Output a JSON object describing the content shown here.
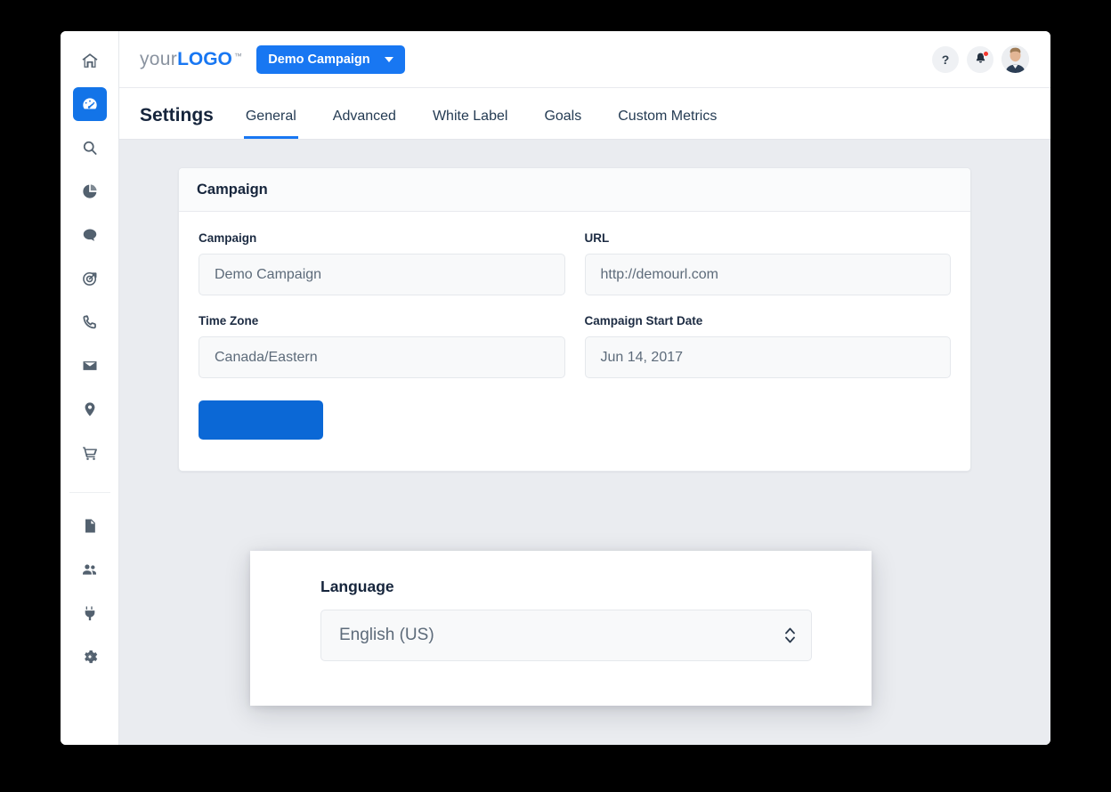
{
  "window": {
    "background_color": "#000000",
    "surface_color": "#ffffff",
    "content_background": "#eaecf0",
    "accent_color": "#1877f2"
  },
  "sidebar": {
    "items": [
      {
        "name": "home",
        "icon": "home-icon",
        "active": false
      },
      {
        "name": "dashboard",
        "icon": "speedometer-icon",
        "active": true
      },
      {
        "name": "search",
        "icon": "search-icon",
        "active": false
      },
      {
        "name": "reports",
        "icon": "pie-chart-icon",
        "active": false
      },
      {
        "name": "chat",
        "icon": "chat-bubble-icon",
        "active": false
      },
      {
        "name": "targeting",
        "icon": "target-arrow-icon",
        "active": false
      },
      {
        "name": "calls",
        "icon": "phone-icon",
        "active": false
      },
      {
        "name": "email",
        "icon": "envelope-icon",
        "active": false
      },
      {
        "name": "locations",
        "icon": "map-pin-icon",
        "active": false
      },
      {
        "name": "ecommerce",
        "icon": "shopping-cart-icon",
        "active": false
      }
    ],
    "items_bottom": [
      {
        "name": "documents",
        "icon": "document-icon",
        "active": false
      },
      {
        "name": "users",
        "icon": "users-icon",
        "active": false
      },
      {
        "name": "integrations",
        "icon": "plug-icon",
        "active": false
      },
      {
        "name": "settings",
        "icon": "gear-icon",
        "active": false
      }
    ]
  },
  "header": {
    "logo_prefix": "your",
    "logo_bold": "LOGO",
    "logo_tm": "™",
    "campaign_selector": "Demo Campaign",
    "help_label": "?",
    "help_icon": "question-mark-icon",
    "notifications_icon": "bell-icon",
    "notification_dot_color": "#f4372e",
    "avatar_icon": "user-avatar"
  },
  "nav": {
    "page_title": "Settings",
    "tabs": [
      {
        "label": "General",
        "active": true
      },
      {
        "label": "Advanced",
        "active": false
      },
      {
        "label": "White Label",
        "active": false
      },
      {
        "label": "Goals",
        "active": false
      },
      {
        "label": "Custom Metrics",
        "active": false
      }
    ]
  },
  "card": {
    "title": "Campaign",
    "fields": [
      {
        "label": "Campaign",
        "value": "Demo Campaign"
      },
      {
        "label": "URL",
        "value": "http://demourl.com"
      },
      {
        "label": "Time Zone",
        "value": "Canada/Eastern"
      },
      {
        "label": "Campaign Start Date",
        "value": "Jun 14, 2017"
      }
    ],
    "save_label": ""
  },
  "overlay": {
    "label": "Language",
    "selected_value": "English (US)",
    "spinner_icon": "chevron-up-down-icon"
  }
}
